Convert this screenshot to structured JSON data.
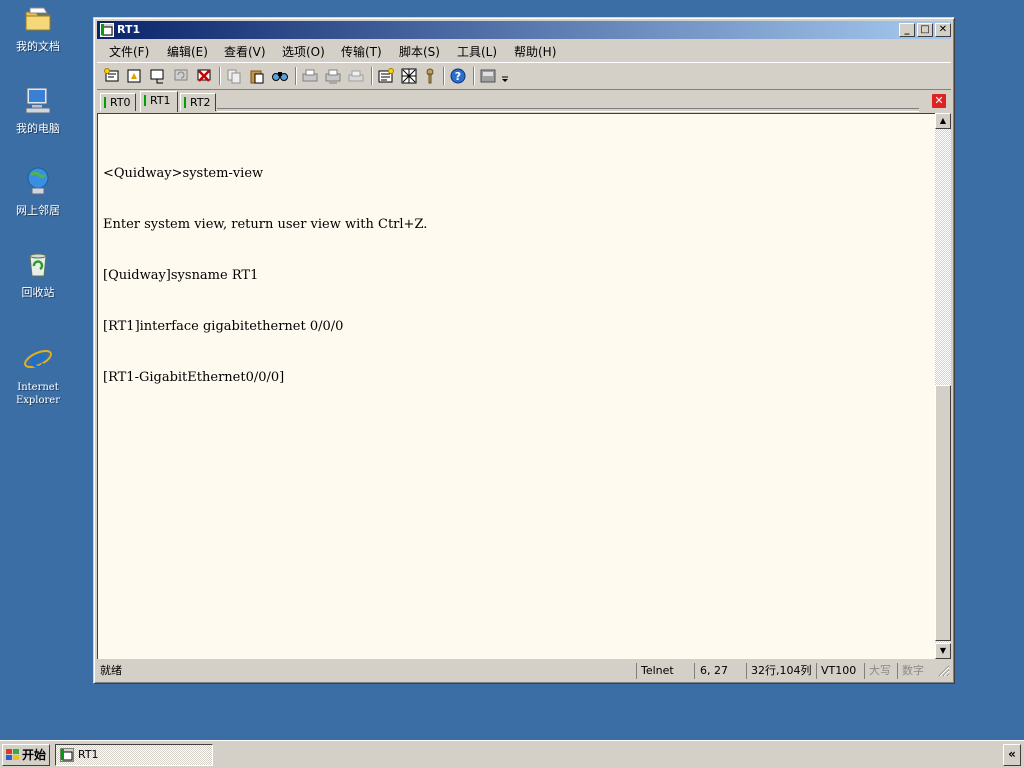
{
  "desktop": {
    "icons": [
      {
        "label": "我的文档"
      },
      {
        "label": "我的电脑"
      },
      {
        "label": "网上邻居"
      },
      {
        "label": "回收站"
      },
      {
        "label": "Internet\nExplorer"
      }
    ]
  },
  "window": {
    "title": "RT1",
    "buttons": {
      "minimize": "_",
      "maximize": "□",
      "close": "✕"
    },
    "menu": [
      "文件(F)",
      "编辑(E)",
      "查看(V)",
      "选项(O)",
      "传输(T)",
      "脚本(S)",
      "工具(L)",
      "帮助(H)"
    ],
    "toolbar_icons": [
      "new-session-icon",
      "quick-connect-icon",
      "connect-icon",
      "reconnect-icon",
      "disconnect-icon",
      "copy-icon",
      "paste-icon",
      "find-icon",
      "print-icon",
      "print-setup-icon",
      "print-preview-icon",
      "session-options-icon",
      "global-options-icon",
      "key-icon",
      "help-icon",
      "keymap-icon",
      "more-icon"
    ],
    "tabs": [
      {
        "label": "RT0",
        "active": false
      },
      {
        "label": "RT1",
        "active": true
      },
      {
        "label": "RT2",
        "active": false
      }
    ],
    "terminal_lines": [
      "<Quidway>system-view",
      "Enter system view, return user view with Ctrl+Z.",
      "[Quidway]sysname RT1",
      "[RT1]interface gigabitethernet 0/0/0",
      "[RT1-GigabitEthernet0/0/0]"
    ],
    "status": {
      "ready": "就绪",
      "protocol": "Telnet",
      "cursor": "6,  27",
      "size": "32行,104列",
      "terminal": "VT100",
      "caps": "大写",
      "num": "数字"
    }
  },
  "taskbar": {
    "start_label": "开始",
    "task_label": "RT1",
    "tray_toggle": "«"
  },
  "colors": {
    "desktop": "#3a6ea5",
    "titlebar_start": "#0a246a",
    "titlebar_end": "#a6caf0",
    "terminal_bg": "#fffaf0"
  }
}
